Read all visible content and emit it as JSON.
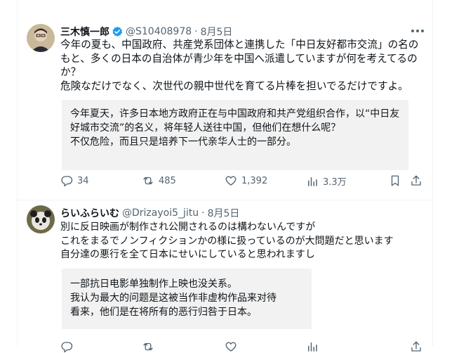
{
  "tweets": [
    {
      "name": "三木慎一郎",
      "handle": "@S10408978",
      "separator": "·",
      "date": "8月5日",
      "body": "今年の夏も、中国政府、共産党系団体と連携した「中日友好都市交流」の名のもと、多くの日本の自治体が青少年を中国へ派遣していますが何を考えてるのか？\n危険なだけでなく、次世代の親中世代を育てる片棒を担いでるだけですよ。",
      "translation": "今年夏天，许多日本地方政府正在与中国政府和共产党组织合作，以“中日友好城市交流”的名义，将年轻人送往中国，但他们在想什么呢？\n不仅危险，而且只是培养下一代亲华人士的一部分。",
      "stats": {
        "replies": "34",
        "reposts": "485",
        "likes": "1,392",
        "views": "3.3万"
      }
    },
    {
      "name": "らいふらいむ",
      "handle": "@Drizayoi5_jitu",
      "separator": "·",
      "date": "8月5日",
      "body": "別に反日映画が制作され公開されるのは構わないんですが\nこれをまるでノンフィクションかの様に扱っているのが大問題だと思います\n自分達の悪行を全て日本にせいにしていると思われますし",
      "translation": "一部抗日电影单独制作上映也没关系。\n我认为最大的问题是这被当作非虚构作品来对待\n看来，他们是在将所有的恶行归咎于日本。"
    }
  ],
  "colors": {
    "verified": "#1d9bf0",
    "muted": "#536471"
  }
}
